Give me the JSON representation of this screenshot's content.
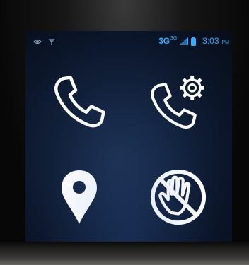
{
  "status_bar": {
    "left_icons": [
      "eye-icon",
      "antenna-icon"
    ],
    "network_type": "3G",
    "network_superscript": "3G",
    "signal_icon": "signal-bars-icon",
    "battery_icon": "battery-icon",
    "time": "3:03",
    "ampm": "PM",
    "accent_color": "#3aa9ff"
  },
  "grid": {
    "tiles": [
      {
        "icon": "phone-handset-icon",
        "action": "call"
      },
      {
        "icon": "phone-gear-icon",
        "action": "call-settings"
      },
      {
        "icon": "location-pin-icon",
        "action": "location"
      },
      {
        "icon": "hand-stop-icon",
        "action": "block"
      }
    ]
  }
}
